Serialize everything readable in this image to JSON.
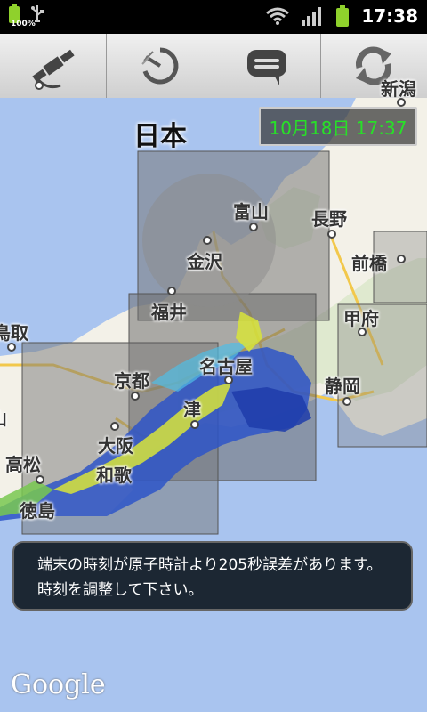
{
  "status_bar": {
    "battery_percent": "100%",
    "time": "17:38",
    "icons": [
      "battery-icon",
      "usb-icon",
      "wifi-icon",
      "signal-icon",
      "battery-icon"
    ]
  },
  "toolbar": {
    "buttons": [
      "satellite-icon",
      "radar-icon",
      "message-icon",
      "refresh-icon"
    ]
  },
  "map": {
    "country": "日本",
    "datetime": "10月18日 17:37",
    "cities": [
      "新潟",
      "富山",
      "長野",
      "金沢",
      "前橋",
      "福井",
      "甲府",
      "鳥取",
      "名古屋",
      "京都",
      "静岡",
      "津",
      "大阪",
      "和歌",
      "高松",
      "徳島",
      "山"
    ],
    "notice": "端末の時刻が原子時計より205秒誤差があります。時刻を調整して下さい。",
    "attribution": "Google",
    "colors": {
      "datetime_text": "#28e028",
      "rain_blue": "#2e55c8",
      "rain_yellow": "#d8e43a"
    }
  }
}
